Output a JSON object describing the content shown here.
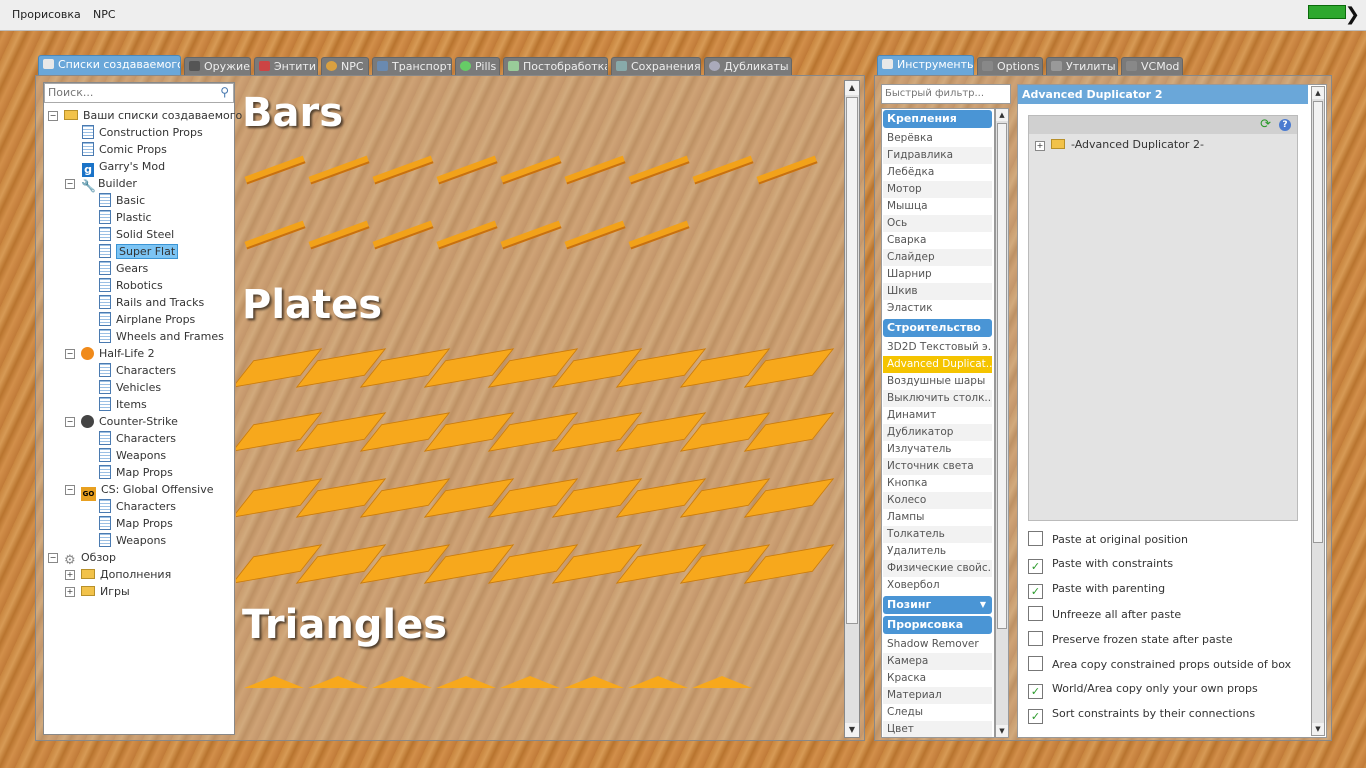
{
  "topbar": {
    "menu": [
      "Прорисовка",
      "NPC"
    ]
  },
  "spawnmenu": {
    "tabs": [
      "Списки создаваемого",
      "Оружие",
      "Энтити",
      "NPC",
      "Транспорт",
      "Pills",
      "Постобработка",
      "Сохранения",
      "Дубликаты"
    ],
    "search_placeholder": "Поиск...",
    "tree": {
      "root": "Ваши списки создаваемого",
      "construction_props": "Construction Props",
      "comic_props": "Comic Props",
      "garrys_mod": "Garry's Mod",
      "builder": "Builder",
      "builder_items": [
        "Basic",
        "Plastic",
        "Solid Steel",
        "Super Flat",
        "Gears",
        "Robotics",
        "Rails and Tracks",
        "Airplane Props",
        "Wheels and Frames"
      ],
      "hl2": "Half-Life 2",
      "hl2_items": [
        "Characters",
        "Vehicles",
        "Items"
      ],
      "cs": "Counter-Strike",
      "cs_items": [
        "Characters",
        "Weapons",
        "Map Props"
      ],
      "csgo": "CS: Global Offensive",
      "csgo_items": [
        "Characters",
        "Map Props",
        "Weapons"
      ],
      "browse": "Обзор",
      "browse_items": [
        "Дополнения",
        "Игры"
      ]
    },
    "headings": [
      "Bars",
      "Plates",
      "Triangles"
    ]
  },
  "toolmenu": {
    "tabs": [
      "Инструменты",
      "Options",
      "Утилиты",
      "VCMod"
    ],
    "filter_placeholder": "Быстрый фильтр...",
    "cat_constraints": "Крепления",
    "constraints": [
      "Верёвка",
      "Гидравлика",
      "Лебёдка",
      "Мотор",
      "Мышца",
      "Ось",
      "Сварка",
      "Слайдер",
      "Шарнир",
      "Шкив",
      "Эластик"
    ],
    "cat_construction": "Строительство",
    "construction": [
      "3D2D Текстовый э...",
      "Advanced Duplicat...",
      "Воздушные шары",
      "Выключить столк...",
      "Динамит",
      "Дубликатор",
      "Излучатель",
      "Источник света",
      "Кнопка",
      "Колесо",
      "Лампы",
      "Толкатель",
      "Удалитель",
      "Физические свойс...",
      "Ховербол"
    ],
    "cat_posing": "Позинг",
    "cat_render": "Прорисовка",
    "render": [
      "Shadow Remover",
      "Камера",
      "Краска",
      "Материал",
      "Следы",
      "Цвет"
    ],
    "panel_title": "Advanced Duplicator 2",
    "dup_root": "-Advanced Duplicator 2-",
    "options": [
      {
        "label": "Paste at original position",
        "checked": false
      },
      {
        "label": "Paste with constraints",
        "checked": true
      },
      {
        "label": "Paste with parenting",
        "checked": true
      },
      {
        "label": "Unfreeze all after paste",
        "checked": false
      },
      {
        "label": "Preserve frozen state after paste",
        "checked": false
      },
      {
        "label": "Area copy constrained props outside of box",
        "checked": false
      },
      {
        "label": "World/Area copy only your own props",
        "checked": true
      },
      {
        "label": "Sort constraints by their connections",
        "checked": true
      }
    ]
  }
}
